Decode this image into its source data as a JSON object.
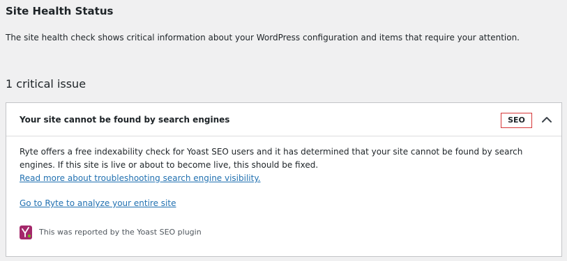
{
  "page": {
    "title": "Site Health Status",
    "intro": "The site health check shows critical information about your WordPress configuration and items that require your attention."
  },
  "issues": {
    "heading": "1 critical issue",
    "items": [
      {
        "title": "Your site cannot be found by search engines",
        "badge": "SEO",
        "badge_color": "#d63638",
        "toggle_icon": "chevron-up-icon",
        "description": "Ryte offers a free indexability check for Yoast SEO users and it has determined that your site cannot be found by search engines. If this site is live or about to become live, this should be fixed.",
        "link_read_more": "Read more about troubleshooting search engine visibility.",
        "link_ryte": "Go to Ryte to analyze your entire site",
        "reported_by": "This was reported by the Yoast SEO plugin",
        "plugin_icon": "yoast-icon"
      }
    ]
  },
  "colors": {
    "background": "#f0f0f1",
    "panel": "#ffffff",
    "link": "#2271b1",
    "critical": "#d63638",
    "yoast": "#a4286a"
  }
}
